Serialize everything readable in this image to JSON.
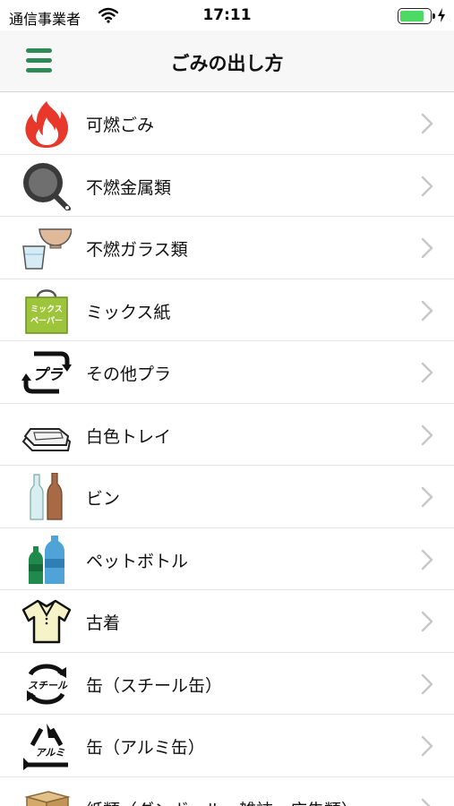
{
  "status_bar": {
    "carrier": "通信事業者",
    "time": "17:11",
    "battery_level": 0.85
  },
  "nav": {
    "title": "ごみの出し方"
  },
  "categories": [
    {
      "label": "可燃ごみ",
      "icon": "flame-icon"
    },
    {
      "label": "不燃金属類",
      "icon": "frying-pan-icon"
    },
    {
      "label": "不燃ガラス類",
      "icon": "bowl-and-glass-icon"
    },
    {
      "label": "ミックス紙",
      "icon": "mixed-paper-bag-icon",
      "icon_text": [
        "ミックス",
        "ペーパー"
      ]
    },
    {
      "label": "その他プラ",
      "icon": "plastic-recycle-icon",
      "icon_text": "プラ"
    },
    {
      "label": "白色トレイ",
      "icon": "white-tray-icon"
    },
    {
      "label": "ビン",
      "icon": "bottles-icon"
    },
    {
      "label": "ペットボトル",
      "icon": "pet-bottles-icon"
    },
    {
      "label": "古着",
      "icon": "polo-shirt-icon"
    },
    {
      "label": "缶（スチール缶）",
      "icon": "steel-can-recycle-icon",
      "icon_text": "スチール"
    },
    {
      "label": "缶（アルミ缶）",
      "icon": "aluminum-can-recycle-icon",
      "icon_text": "アルミ"
    },
    {
      "label": "紙類（ダンボール・雑誌・広告類）",
      "icon": "cardboard-box-icon"
    }
  ],
  "colors": {
    "accent": "#2e8b57",
    "flame": "#e8382b",
    "mixed_paper": "#9dc43a",
    "chevron": "#c7c7cc"
  }
}
